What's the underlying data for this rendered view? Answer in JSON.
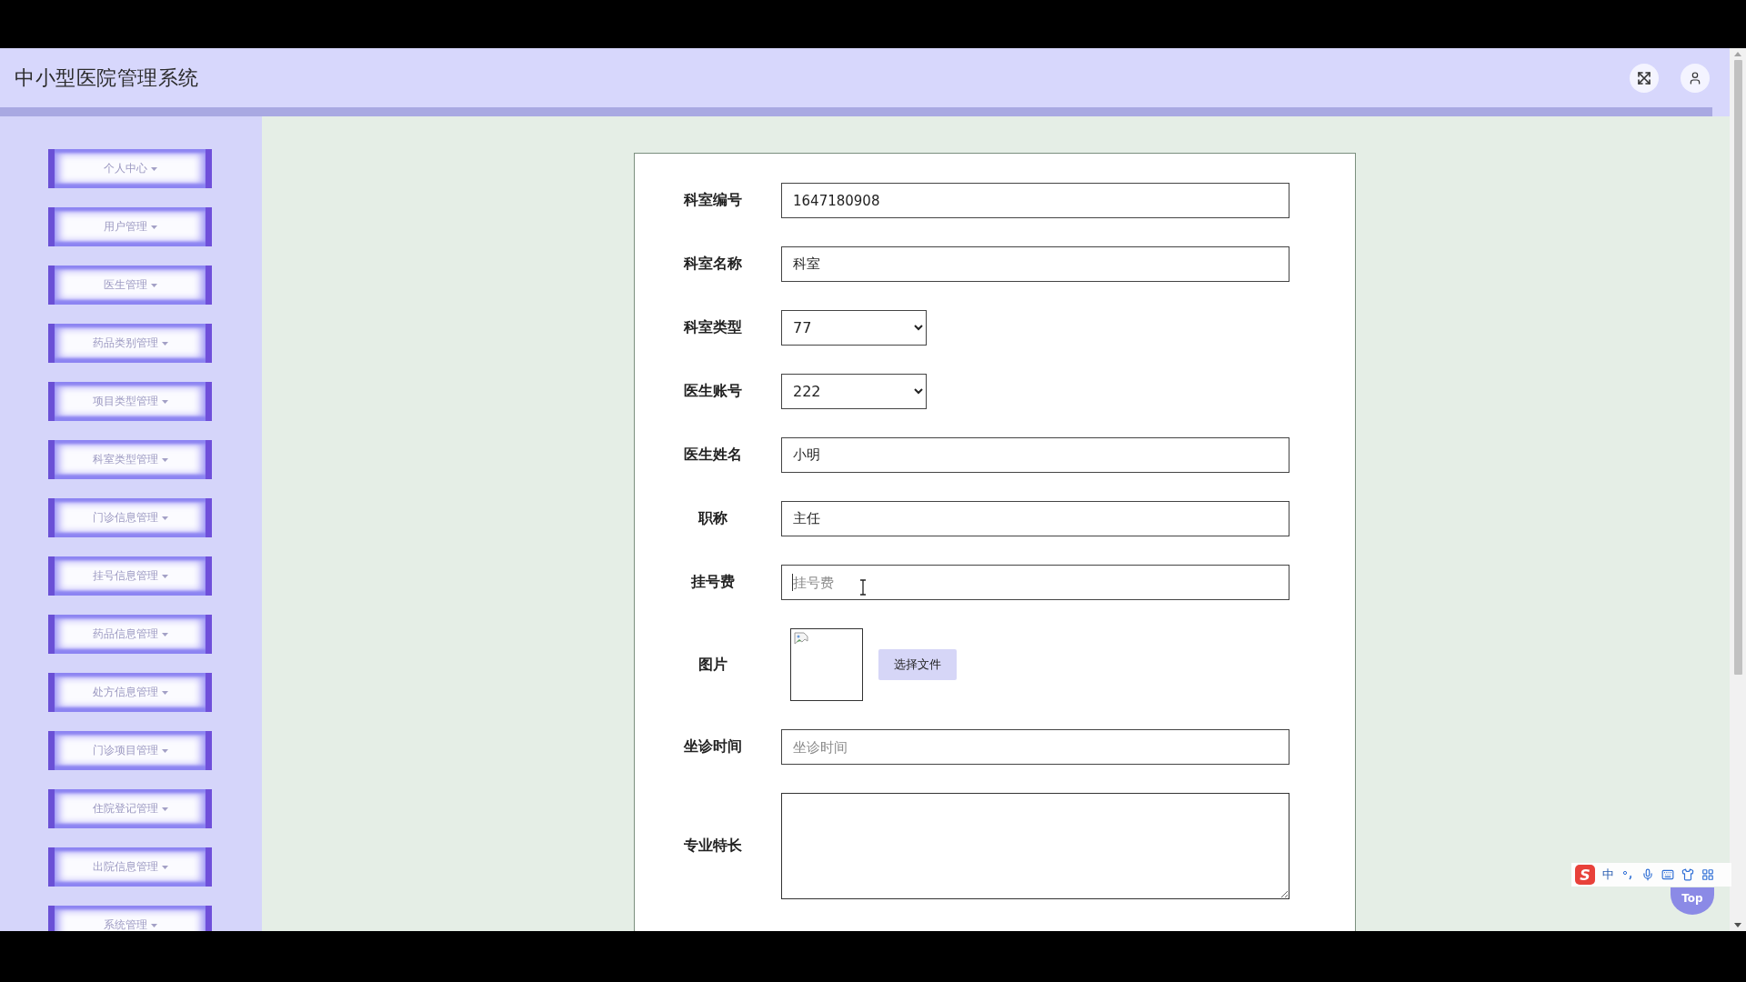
{
  "header": {
    "title": "中小型医院管理系统"
  },
  "sidebar": {
    "items": [
      {
        "label": "个人中心"
      },
      {
        "label": "用户管理"
      },
      {
        "label": "医生管理"
      },
      {
        "label": "药品类别管理"
      },
      {
        "label": "项目类型管理"
      },
      {
        "label": "科室类型管理"
      },
      {
        "label": "门诊信息管理"
      },
      {
        "label": "挂号信息管理"
      },
      {
        "label": "药品信息管理"
      },
      {
        "label": "处方信息管理"
      },
      {
        "label": "门诊项目管理"
      },
      {
        "label": "住院登记管理"
      },
      {
        "label": "出院信息管理"
      },
      {
        "label": "系统管理"
      }
    ]
  },
  "form": {
    "fields": [
      {
        "kind": "text",
        "label": "科室编号",
        "value": "1647180908"
      },
      {
        "kind": "text",
        "label": "科室名称",
        "value": "科室"
      },
      {
        "kind": "select",
        "label": "科室类型",
        "value": "77"
      },
      {
        "kind": "select",
        "label": "医生账号",
        "value": "222"
      },
      {
        "kind": "text",
        "label": "医生姓名",
        "value": "小明"
      },
      {
        "kind": "text",
        "label": "职称",
        "value": "主任"
      },
      {
        "kind": "text",
        "label": "挂号费",
        "placeholder": "挂号费",
        "focused": true
      },
      {
        "kind": "image",
        "label": "图片",
        "button": "选择文件"
      },
      {
        "kind": "text",
        "label": "坐诊时间",
        "placeholder": "坐诊时间"
      },
      {
        "kind": "textarea",
        "label": "专业特长"
      }
    ]
  },
  "back_to_top": {
    "label": "Top"
  },
  "ime_toolbar": {
    "logo": "S",
    "language": "中"
  }
}
